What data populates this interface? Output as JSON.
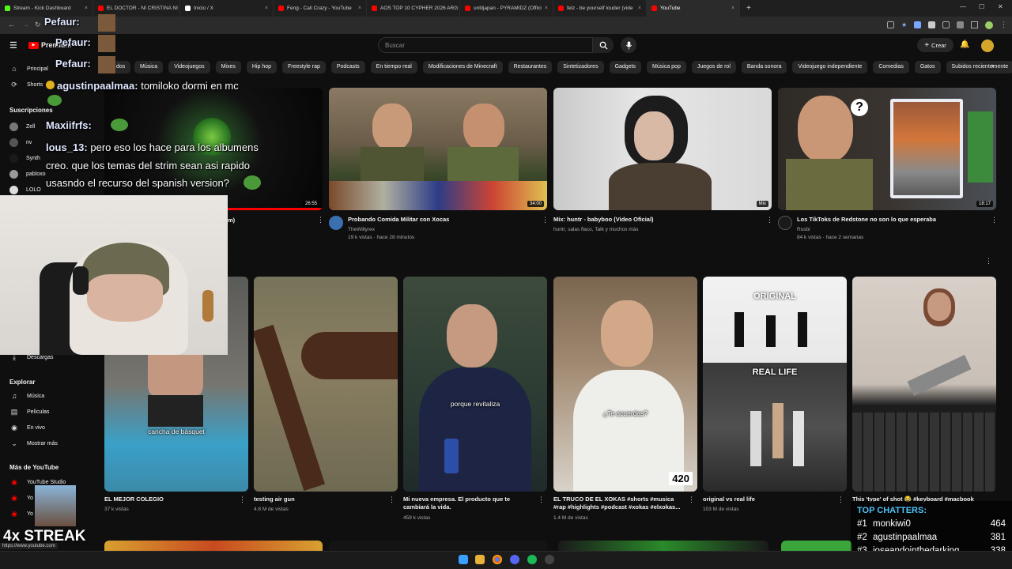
{
  "tabs": [
    {
      "label": "Stream - Kick Dashboard",
      "color": "#53fc18"
    },
    {
      "label": "EL DOCTOR - NI CRISTINA NI L",
      "color": "#ff0000"
    },
    {
      "label": "Inicio / X",
      "color": "#ffffff"
    },
    {
      "label": "Feng - Cali Crazy - YouTube",
      "color": "#ff0000"
    },
    {
      "label": "AOS TOP 10 CYPHER 2026 ARG",
      "color": "#ff0000"
    },
    {
      "label": "untiljapan - PYRAMIDZ (Offici",
      "color": "#ff0000"
    },
    {
      "label": "felz - be yourself louder (vide",
      "color": "#ff0000"
    },
    {
      "label": "YouTube",
      "color": "#ff0000"
    }
  ],
  "header": {
    "logo": "Premium",
    "search_placeholder": "Buscar",
    "create_label": "Crear"
  },
  "chips": [
    "Música",
    "Videojuegos",
    "Mixes",
    "Hip hop",
    "Freestyle rap",
    "Podcasts",
    "En tiempo real",
    "Modificaciones de Minecraft",
    "Restaurantes",
    "Sintetizadores",
    "Gadgets",
    "Música pop",
    "Juegos de rol",
    "Banda sonora",
    "Videojuego independiente",
    "Comedias",
    "Gatos",
    "Subidos recientemente",
    "V"
  ],
  "chip_first_partial": "dos",
  "sidebar": {
    "principal": "Principal",
    "shorts": "Shorts",
    "suscripciones": "Suscripciones",
    "subs": [
      "Zell",
      "nv",
      "Synth",
      "pabloxo",
      "LOLO"
    ],
    "descargas": "Descargas",
    "explorar": "Explorar",
    "explorar_items": [
      "Música",
      "Películas",
      "En vivo",
      "Mostrar más"
    ],
    "mas_youtube": "Más de YouTube",
    "mas_items": [
      "YouTube Studio",
      "Yo",
      "Yo"
    ]
  },
  "videos_row1": [
    {
      "title": "m)",
      "meta1": "",
      "meta2": "",
      "duration": "26:55"
    },
    {
      "title": "Probando Comida Militar con Xocas",
      "meta1": "TheWillyrex",
      "meta2": "19 k vistas · hace 28 minutos",
      "duration": "34:00"
    },
    {
      "title": "Mix: huntr - babyboo (Video Oficial)",
      "meta1": "huntr, salas flaco, Talk y muchos más",
      "meta2": "",
      "duration": "Mix"
    },
    {
      "title": "Los TikToks de Redstone no son lo que esperaba",
      "meta1": "Rusbi",
      "meta2": "84 k vistas · hace 2 semanas",
      "duration": "18:17"
    }
  ],
  "shorts": [
    {
      "title": "EL MEJOR COLEGIO",
      "meta": "37 k vistas",
      "caption": "cancha de básquet"
    },
    {
      "title": "testing air gun",
      "meta": "4.8 M de vistas",
      "caption": ""
    },
    {
      "title": "Mi nueva empresa. El producto que te cambiará la vida.",
      "meta": "459 k vistas",
      "caption": "porque revitaliza"
    },
    {
      "title": "EL TRUCO DE EL XOKAS #shorts #musica #rap #highlights #podcast #xokas #elxokas...",
      "meta": "1.4 M de vistas",
      "caption": "¿Te acuerdas?"
    },
    {
      "title": "original vs real life",
      "meta": "103 M de vistas",
      "caption_top": "ORIGINAL",
      "caption": "REAL LIFE"
    },
    {
      "title": "This 'type' of shot 😂 #keyboard #macbook",
      "meta": "",
      "caption": ""
    }
  ],
  "short_badge": "420",
  "chat": [
    {
      "user": "Pefaur:",
      "text": ""
    },
    {
      "user": "Pefaur:",
      "text": ""
    },
    {
      "user": "Pefaur:",
      "text": ""
    },
    {
      "user": "agustinpaalmaa:",
      "text": "tomiloko dormi en mc"
    },
    {
      "user": "Maxiifrfs:",
      "text": ""
    },
    {
      "user": "lous_13:",
      "text": "pero eso los hace para los albumens"
    },
    {
      "user": "",
      "text": "creo. que los temas del strim sean asi rapido"
    },
    {
      "user": "",
      "text": "usasndo el recurso del spanish version?"
    }
  ],
  "streak": "4x STREAK",
  "top_chatters": {
    "heading": "TOP CHATTERS:",
    "rows": [
      {
        "rank": "#1",
        "name": "monkiwi0",
        "count": "464"
      },
      {
        "rank": "#2",
        "name": "agustinpaalmaa",
        "count": "381"
      },
      {
        "rank": "#3",
        "name": "joseandointhedarking",
        "count": "338"
      }
    ]
  },
  "status_url": "https://www.youtube.com"
}
